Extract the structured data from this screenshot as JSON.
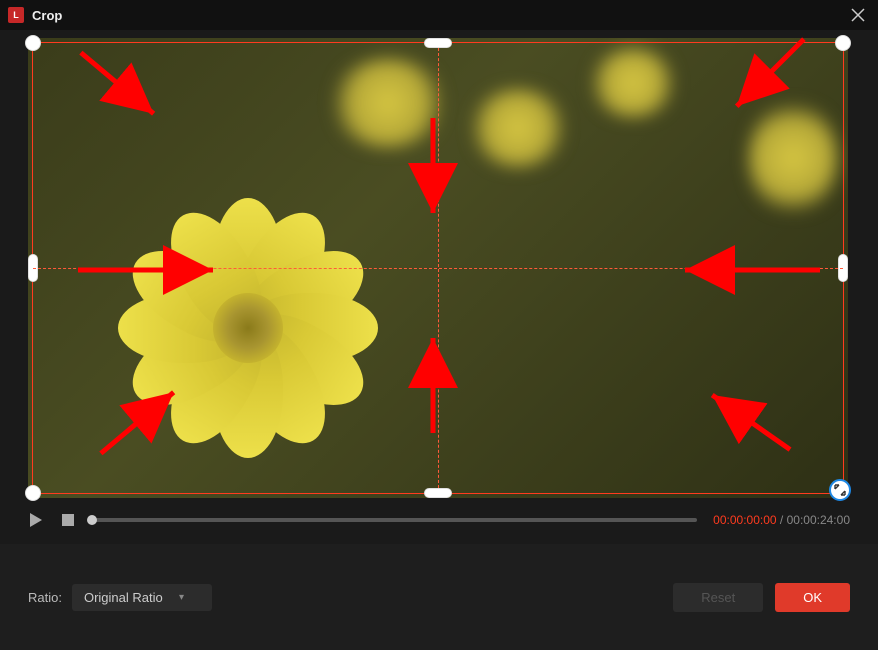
{
  "titlebar": {
    "app_icon_text": "L",
    "title": "Crop"
  },
  "playback": {
    "current_time": "00:00:00:00",
    "separator": " / ",
    "duration": "00:00:24:00"
  },
  "footer": {
    "ratio_label": "Ratio:",
    "ratio_selected": "Original Ratio",
    "reset_label": "Reset",
    "ok_label": "OK"
  },
  "colors": {
    "accent_red": "#e03a2a",
    "time_red": "#ff3b1f",
    "crop_border": "#ff3b1f",
    "annotation_red": "#ff0000"
  },
  "annotations": {
    "arrows": 8
  }
}
